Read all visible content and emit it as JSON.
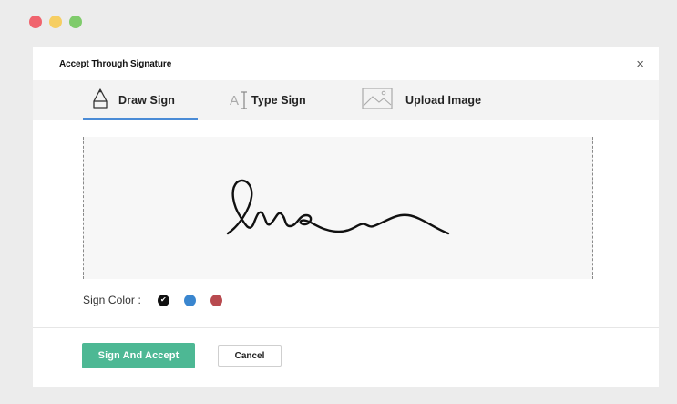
{
  "window": {
    "controls": [
      "close",
      "minimize",
      "maximize"
    ]
  },
  "modal": {
    "title": "Accept Through Signature",
    "close_glyph": "×"
  },
  "tabs": [
    {
      "label": "Draw Sign",
      "icon": "pen-nib-icon",
      "active": true
    },
    {
      "label": "Type Sign",
      "icon": "text-cursor-icon",
      "active": false
    },
    {
      "label": "Upload Image",
      "icon": "image-icon",
      "active": false
    }
  ],
  "tab_icons": {
    "type_sign_letter": "A"
  },
  "signature": {
    "color": "#111111"
  },
  "sign_color": {
    "label": "Sign Color :",
    "options": [
      {
        "name": "black",
        "hex": "#111111",
        "selected": true
      },
      {
        "name": "blue",
        "hex": "#3a86cf",
        "selected": false
      },
      {
        "name": "red",
        "hex": "#b84a4f",
        "selected": false
      }
    ],
    "check_glyph": "✔"
  },
  "actions": {
    "primary_label": "Sign And Accept",
    "secondary_label": "Cancel"
  },
  "colors": {
    "accent_tab": "#4a8bd6",
    "primary_button": "#4db894"
  }
}
